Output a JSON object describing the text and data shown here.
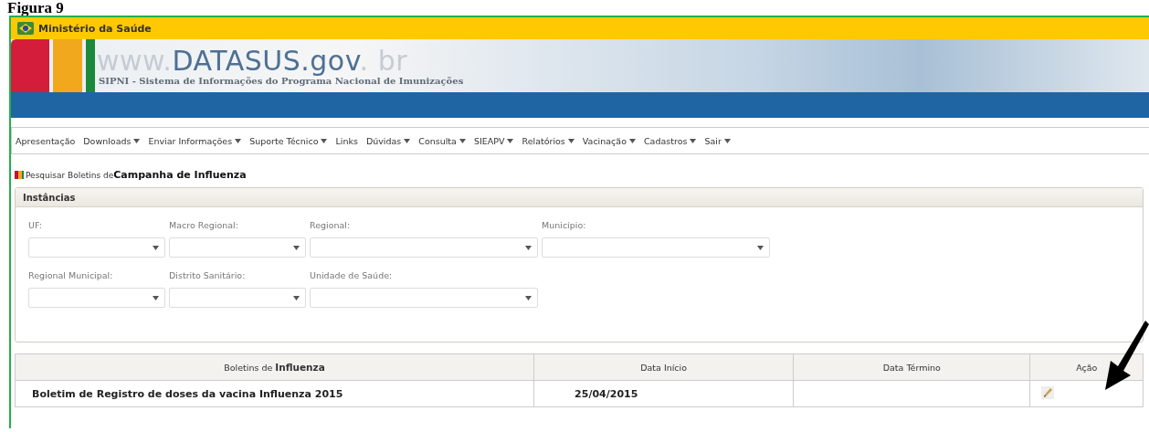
{
  "caption": "Figura 9",
  "top_bar": {
    "title": "Ministério da Saúde"
  },
  "banner": {
    "site_name": [
      {
        "text": "www.",
        "kind": "faint"
      },
      {
        "text": "DATASUS.gov",
        "kind": "strong"
      },
      {
        "text": ". br",
        "kind": "faint"
      }
    ],
    "subtitle": "SIPNI - Sistema de Informações do Programa Nacional de Imunizações"
  },
  "menu": [
    {
      "label": "Apresentação",
      "dropdown": false
    },
    {
      "label": "Downloads",
      "dropdown": true
    },
    {
      "label": "Enviar Informações",
      "dropdown": true
    },
    {
      "label": "Suporte Técnico",
      "dropdown": true
    },
    {
      "label": "Links",
      "dropdown": false
    },
    {
      "label": "Dúvidas",
      "dropdown": true
    },
    {
      "label": "Consulta",
      "dropdown": true
    },
    {
      "label": "SIEAPV",
      "dropdown": true
    },
    {
      "label": "Relatórios",
      "dropdown": true
    },
    {
      "label": "Vacinação",
      "dropdown": true
    },
    {
      "label": "Cadastros",
      "dropdown": true
    },
    {
      "label": "Sair",
      "dropdown": true
    }
  ],
  "page_title": "Pesquisar Boletins de**Campanha de Influenza**",
  "filters": {
    "title": "Instâncias",
    "rows": [
      [
        {
          "label": "UF:",
          "kind": "narrow"
        },
        {
          "label": "Macro Regional:",
          "kind": "narrow"
        },
        {
          "label": "Regional:",
          "kind": "wide"
        },
        {
          "label": "Município:",
          "kind": "wide"
        }
      ],
      [
        {
          "label": "Regional Municipal:",
          "kind": "narrow"
        },
        {
          "label": "Distrito Sanitário:",
          "kind": "narrow"
        },
        {
          "label": "Unidade de Saúde:",
          "kind": "wide"
        }
      ]
    ]
  },
  "table": {
    "columns": [
      "Boletins de **Influenza**",
      "Data Início",
      "Data Término",
      "Ação"
    ],
    "rows": [
      {
        "name": "Boletim de Registro de doses da vacina Influenza 2015",
        "start": "25/04/2015"
      }
    ]
  }
}
